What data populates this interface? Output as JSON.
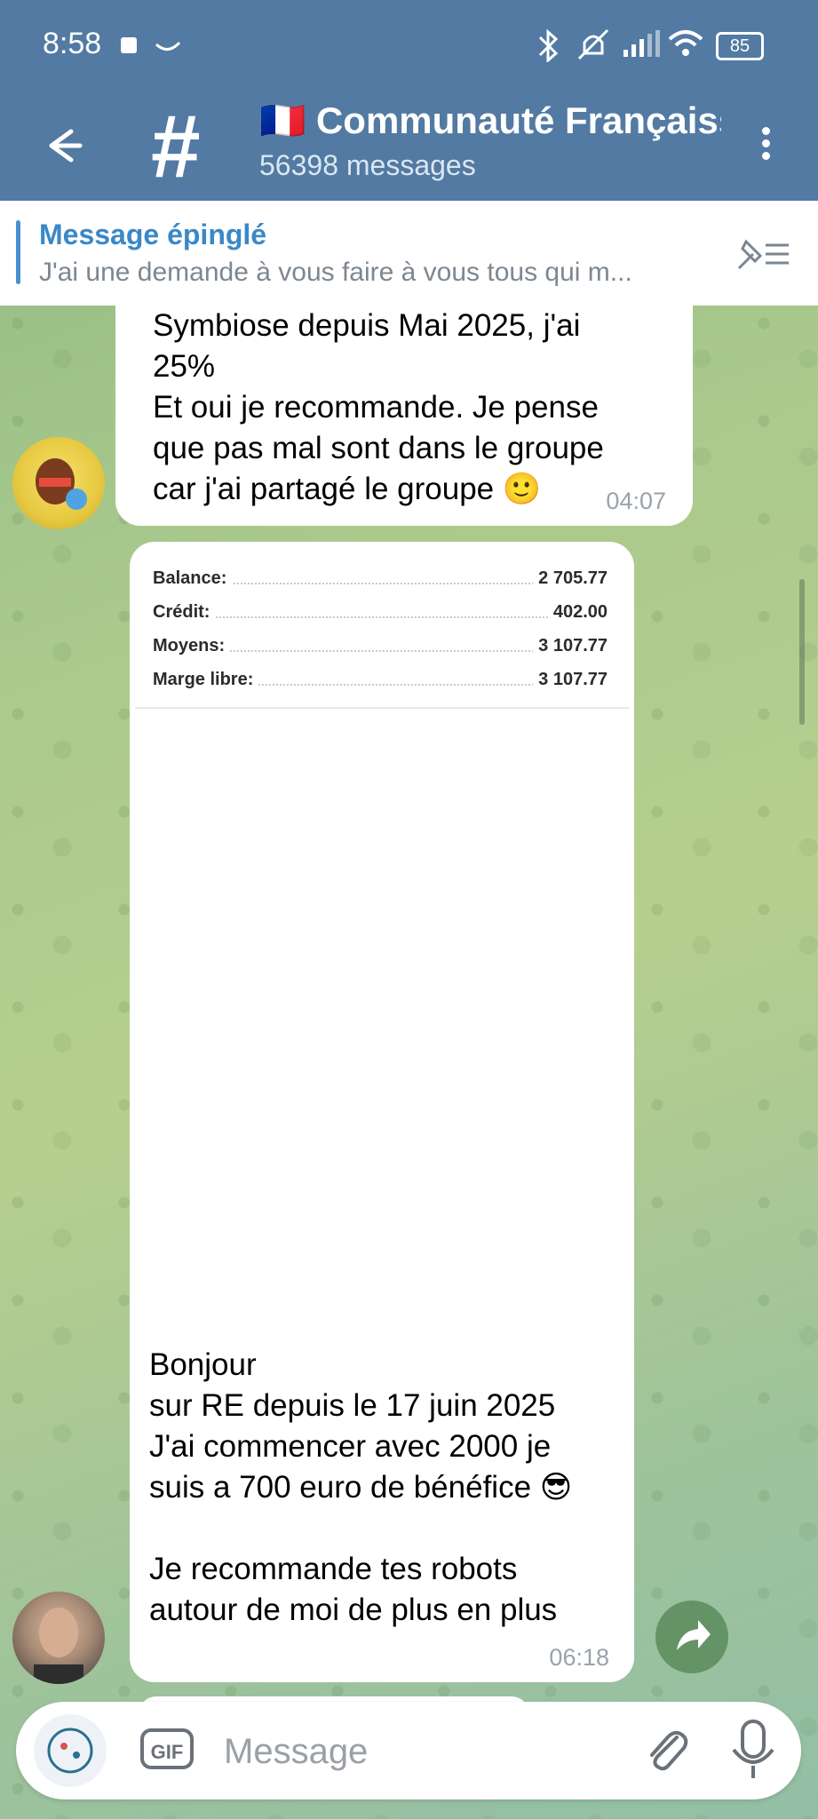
{
  "status_bar": {
    "time": "8:58",
    "battery": "85"
  },
  "header": {
    "flag": "🇫🇷",
    "title": "Communauté Françaiss",
    "subtitle": "56398 messages"
  },
  "pinned": {
    "label": "Message épinglé",
    "preview": "J'ai une demande à vous faire à vous tous qui m..."
  },
  "messages": [
    {
      "text": "Symbiose depuis Mai 2025, j'ai\n25%\nEt oui je recommande. Je pense\nque pas mal sont dans le groupe\ncar j'ai partagé le groupe 🙂",
      "time": "04:07"
    },
    {
      "balance": [
        {
          "label": "Balance:",
          "value": "2 705.77"
        },
        {
          "label": "Crédit:",
          "value": "402.00"
        },
        {
          "label": "Moyens:",
          "value": "3 107.77"
        },
        {
          "label": "Marge libre:",
          "value": "3 107.77"
        }
      ],
      "text": "Bonjour\nsur RE depuis le 17 juin 2025\nJ'ai commencer avec 2000 je\nsuis a 700 euro de bénéfice 😎\n\nJe recommande tes robots\nautour de moi de plus en plus",
      "time": "06:18"
    }
  ],
  "composer": {
    "placeholder": "Message",
    "gif_label": "GIF"
  },
  "colors": {
    "header": "#527aa3",
    "accent": "#3a88c8"
  },
  "icons": [
    "back-arrow-icon",
    "hash-icon",
    "more-vertical-icon",
    "unpin-icon",
    "share-icon",
    "attach-icon",
    "mic-icon",
    "bot-icon"
  ]
}
